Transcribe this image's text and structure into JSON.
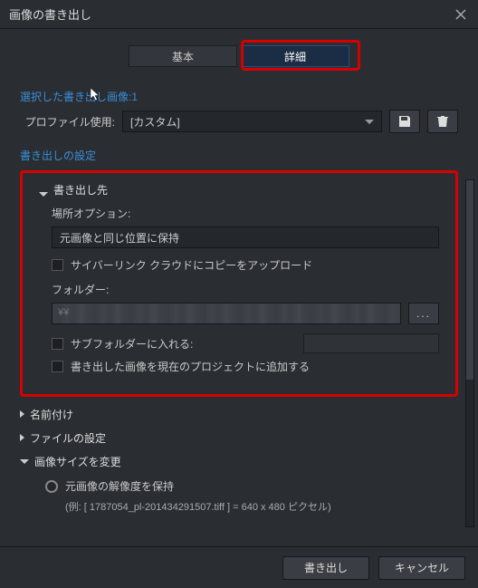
{
  "title": "画像の書き出し",
  "tabs": {
    "basic": "基本",
    "advanced": "詳細"
  },
  "selected_count_label": "選択した書き出し画像:",
  "selected_count": "1",
  "profile": {
    "label": "プロファイル使用:",
    "value": "[カスタム]"
  },
  "export_settings_label": "書き出しの設定",
  "sections": {
    "destination": {
      "title": "書き出し先",
      "location_option_label": "場所オプション:",
      "location_option_value": "元画像と同じ位置に保持",
      "upload_cl": "サイバーリンク クラウドにコピーをアップロード",
      "folder_label": "フォルダー:",
      "folder_path_prefix": "¥¥",
      "browse_label": "...",
      "subfolder": "サブフォルダーに入れる:",
      "add_to_project": "書き出した画像を現在のプロジェクトに追加する"
    },
    "naming": "名前付け",
    "file_settings": "ファイルの設定",
    "resize": {
      "title": "画像サイズを変更",
      "keep_res": "元画像の解像度を保持",
      "example": "(例: [ 1787054_pl-201434291507.tiff ]  =  640 x 480 ピクセル)"
    }
  },
  "footer": {
    "export": "書き出し",
    "cancel": "キャンセル"
  }
}
